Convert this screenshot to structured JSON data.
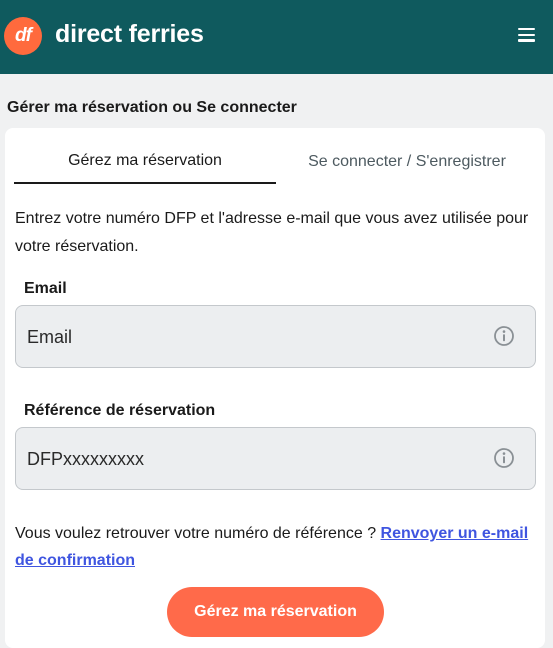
{
  "header": {
    "logo_text": "df",
    "brand": "direct ferries",
    "menu_icon": "hamburger-menu-icon",
    "colors": {
      "bar": "#0f5a5e",
      "logo": "#ff6a3d"
    }
  },
  "page": {
    "section_title": "Gérer ma réservation ou Se connecter"
  },
  "tabs": [
    {
      "label": "Gérez ma réservation",
      "active": true
    },
    {
      "label": "Se connecter / S'enregistrer",
      "active": false
    }
  ],
  "form": {
    "intro": "Entrez votre numéro DFP et l'adresse e-mail que vous avez utilisée pour votre réservation.",
    "email": {
      "label": "Email",
      "placeholder": "Email",
      "value": ""
    },
    "reference": {
      "label": "Référence de réservation",
      "placeholder": "DFPxxxxxxxxx",
      "value": ""
    },
    "info_icon": "info-circle-icon",
    "help_text": "Vous voulez retrouver votre numéro de référence ? ",
    "help_link": "Renvoyer un e-mail de confirmation",
    "submit_label": "Gérez ma réservation",
    "colors": {
      "link": "#3f55e0",
      "button": "#ff6a4a"
    }
  }
}
